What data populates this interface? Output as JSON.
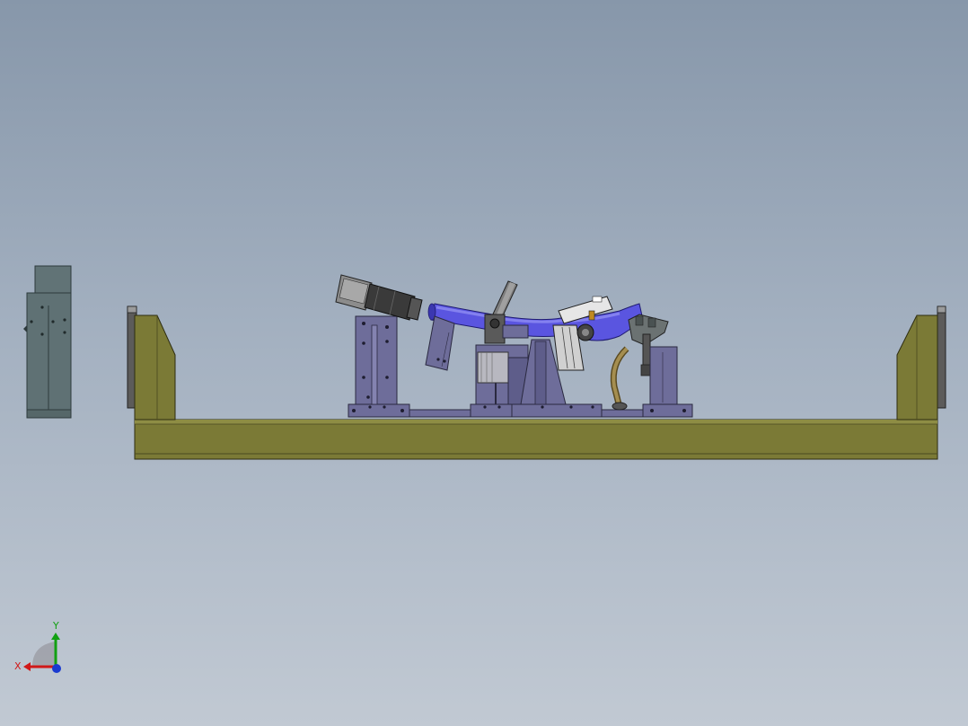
{
  "viewport": {
    "background_top": "#8797aa",
    "background_bottom": "#c1c9d3"
  },
  "model": {
    "colors": {
      "base_frame": "#7b7a36",
      "base_frame_top": "#8e8d44",
      "fixture_steel": "#6e6d9a",
      "fixture_dark": "#4f4e78",
      "tube": "#5a55e0",
      "tube_highlight": "#8f8cf2",
      "cylinder_grey": "#8c8c8c",
      "cylinder_dark": "#3a3a3a",
      "side_block": "#5f7174",
      "hose": "#8a7440"
    }
  },
  "triad": {
    "x_label": "X",
    "y_label": "Y",
    "x_color": "#d01818",
    "y_color": "#12a012",
    "z_color": "#1a3ad0"
  }
}
